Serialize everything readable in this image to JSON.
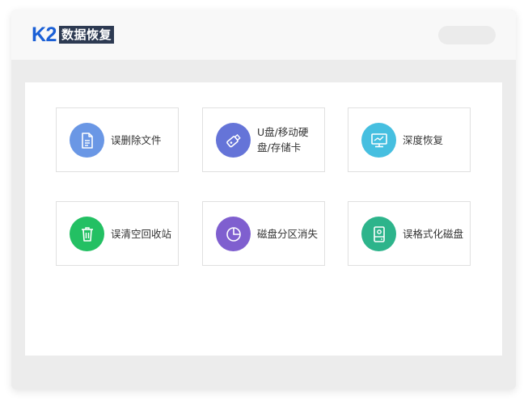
{
  "logo": {
    "brand": "K2",
    "name": "数据恢复"
  },
  "colors": {
    "brand_blue": "#1a5fd6",
    "logo_bg": "#2d3a52",
    "icon_blue": "#6a97e5",
    "icon_purple": "#6574d8",
    "icon_cyan": "#46bfe0",
    "icon_green": "#23c063",
    "icon_violet": "#7f5fcf",
    "icon_teal": "#2db48b"
  },
  "options": [
    {
      "label": "误删除文件",
      "icon": "document-icon"
    },
    {
      "label": "U盘/移动硬盘/存储卡",
      "icon": "usb-drive-icon"
    },
    {
      "label": "深度恢复",
      "icon": "monitor-icon"
    },
    {
      "label": "误清空回收站",
      "icon": "trash-icon"
    },
    {
      "label": "磁盘分区消失",
      "icon": "pie-chart-icon"
    },
    {
      "label": "误格式化磁盘",
      "icon": "hard-drive-icon"
    }
  ]
}
